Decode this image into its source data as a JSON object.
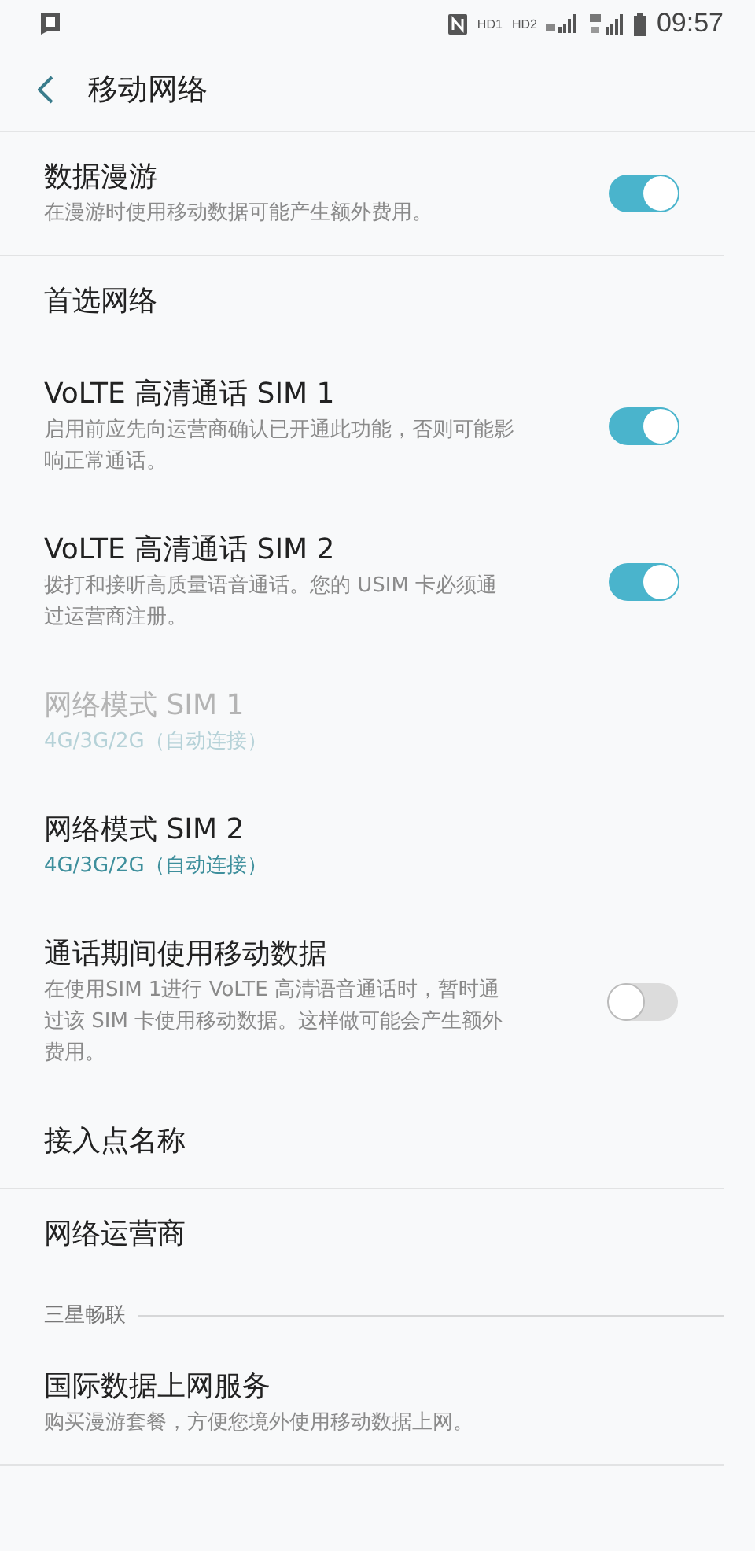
{
  "status_bar": {
    "indicators": [
      "HD1",
      "HD2"
    ],
    "time": "09:57"
  },
  "app_bar": {
    "title": "移动网络"
  },
  "items": [
    {
      "kind": "toggle",
      "title": "数据漫游",
      "subtitle": "在漫游时使用移动数据可能产生额外费用。",
      "on": true,
      "disabled": false,
      "divider": true
    },
    {
      "kind": "plain",
      "title": "首选网络",
      "disabled": false,
      "divider": false
    },
    {
      "kind": "toggle",
      "title": "VoLTE 高清通话 SIM 1",
      "subtitle": "启用前应先向运营商确认已开通此功能，否则可能影响正常通话。",
      "on": true,
      "disabled": false,
      "divider": false
    },
    {
      "kind": "toggle",
      "title": "VoLTE 高清通话 SIM 2",
      "subtitle": "拨打和接听高质量语音通话。您的 USIM 卡必须通过运营商注册。",
      "on": true,
      "disabled": false,
      "divider": false
    },
    {
      "kind": "value",
      "title": "网络模式 SIM 1",
      "subtitle": "4G/3G/2G（自动连接）",
      "disabled": true,
      "divider": false
    },
    {
      "kind": "value",
      "title": "网络模式 SIM 2",
      "subtitle": "4G/3G/2G（自动连接）",
      "disabled": false,
      "divider": false
    },
    {
      "kind": "toggle",
      "title": "通话期间使用移动数据",
      "subtitle": "在使用SIM 1进行 VoLTE 高清语音通话时，暂时通过该 SIM 卡使用移动数据。这样做可能会产生额外费用。",
      "on": false,
      "disabled": false,
      "divider": false
    },
    {
      "kind": "plain",
      "title": "接入点名称",
      "disabled": false,
      "divider": true
    },
    {
      "kind": "plain",
      "title": "网络运营商",
      "disabled": false,
      "divider": false
    },
    {
      "kind": "section",
      "title": "三星畅联"
    },
    {
      "kind": "plain",
      "title": "国际数据上网服务",
      "subtitle": "购买漫游套餐，方便您境外使用移动数据上网。",
      "disabled": false,
      "divider": true
    }
  ]
}
